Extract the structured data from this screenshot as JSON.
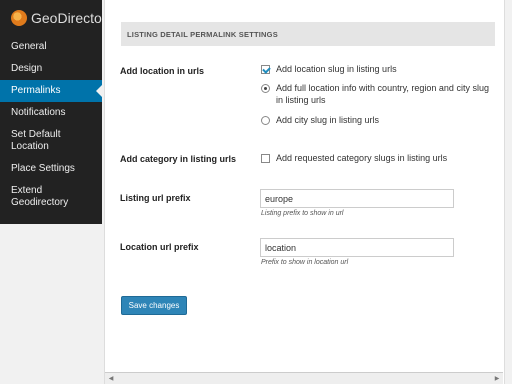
{
  "sidebar": {
    "brand": "GeoDirectory",
    "items": [
      {
        "label": "General"
      },
      {
        "label": "Design"
      },
      {
        "label": "Permalinks"
      },
      {
        "label": "Notifications"
      },
      {
        "label": "Set Default Location"
      },
      {
        "label": "Place Settings"
      },
      {
        "label": "Extend Geodirectory"
      }
    ]
  },
  "main": {
    "section_title": "LISTING DETAIL PERMALINK SETTINGS",
    "add_location": {
      "label": "Add location in urls",
      "checkbox_label": "Add location slug in listing urls",
      "radio_full": "Add full location info with country, region and city slug in listing urls",
      "radio_city": "Add city slug in listing urls"
    },
    "add_category": {
      "label": "Add category in listing urls",
      "checkbox_label": "Add requested category slugs in listing urls"
    },
    "listing_prefix": {
      "label": "Listing url prefix",
      "value": "europe",
      "hint": "Listing prefix to show in url"
    },
    "location_prefix": {
      "label": "Location url prefix",
      "value": "location",
      "hint": "Prefix to show in location url"
    },
    "save_label": "Save changes"
  },
  "colors": {
    "accent": "#0073aa",
    "button": "#2e85b7",
    "sidebar_bg": "#222222"
  }
}
